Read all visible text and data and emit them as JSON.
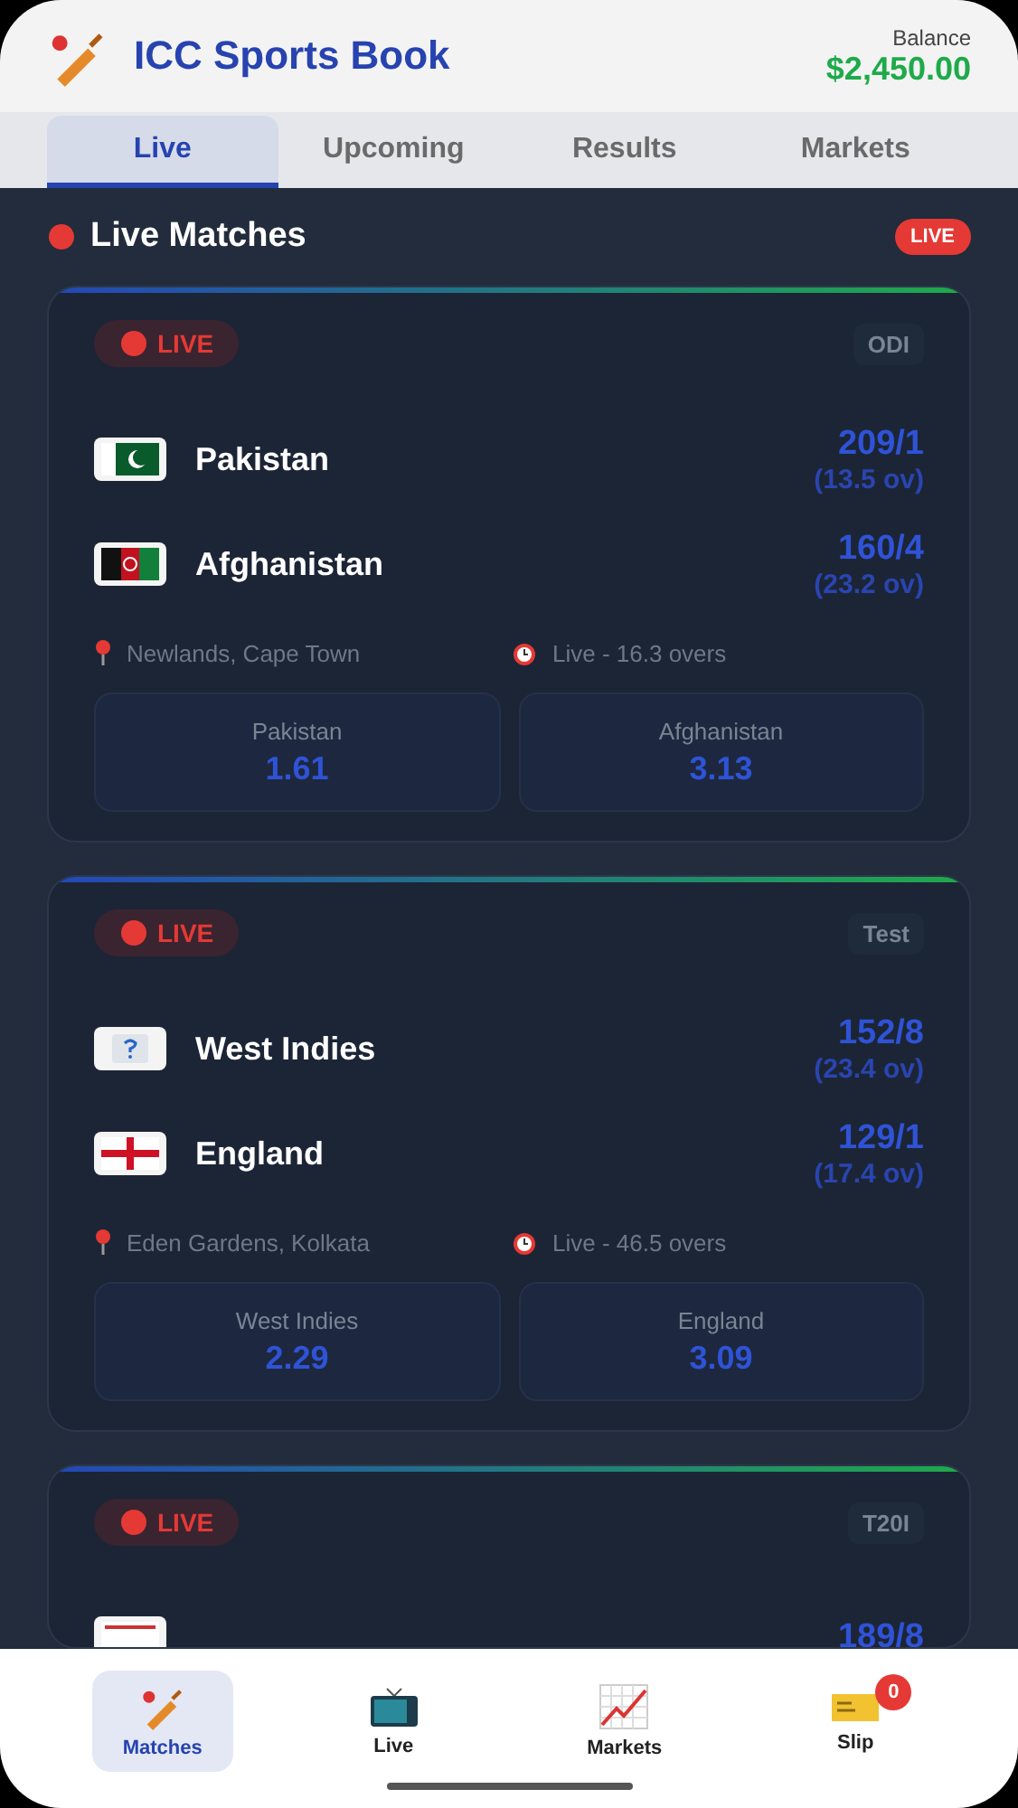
{
  "header": {
    "title": "ICC Sports Book",
    "balance_label": "Balance",
    "balance": "$2,450.00"
  },
  "tabs": [
    {
      "label": "Live",
      "selected": true
    },
    {
      "label": "Upcoming",
      "selected": false
    },
    {
      "label": "Results",
      "selected": false
    },
    {
      "label": "Markets",
      "selected": false
    }
  ],
  "section": {
    "title": "Live Matches",
    "badge": "LIVE"
  },
  "matches": [
    {
      "status": "LIVE",
      "format": "ODI",
      "teams": [
        {
          "name": "Pakistan",
          "kind": "pakistan",
          "score": "209/1",
          "overs": "(13.5 ov)"
        },
        {
          "name": "Afghanistan",
          "kind": "afghanistan",
          "score": "160/4",
          "overs": "(23.2 ov)"
        }
      ],
      "venue": "Newlands, Cape Town",
      "progress": "Live - 16.3 overs",
      "odds": [
        {
          "team": "Pakistan",
          "price": "1.61"
        },
        {
          "team": "Afghanistan",
          "price": "3.13"
        }
      ]
    },
    {
      "status": "LIVE",
      "format": "Test",
      "teams": [
        {
          "name": "West Indies",
          "kind": "unknown",
          "score": "152/8",
          "overs": "(23.4 ov)"
        },
        {
          "name": "England",
          "kind": "england",
          "score": "129/1",
          "overs": "(17.4 ov)"
        }
      ],
      "venue": "Eden Gardens, Kolkata",
      "progress": "Live - 46.5 overs",
      "odds": [
        {
          "team": "West Indies",
          "price": "2.29"
        },
        {
          "team": "England",
          "price": "3.09"
        }
      ]
    },
    {
      "status": "LIVE",
      "format": "T20I",
      "teams": [
        {
          "kind": "other",
          "score": "189/8"
        }
      ]
    }
  ],
  "nav": [
    {
      "label": "Matches",
      "kind": "bat",
      "selected": true
    },
    {
      "label": "Live",
      "kind": "tv",
      "selected": false
    },
    {
      "label": "Markets",
      "kind": "chart",
      "selected": false
    },
    {
      "label": "Slip",
      "kind": "ticket",
      "selected": false,
      "badge": "0"
    }
  ]
}
